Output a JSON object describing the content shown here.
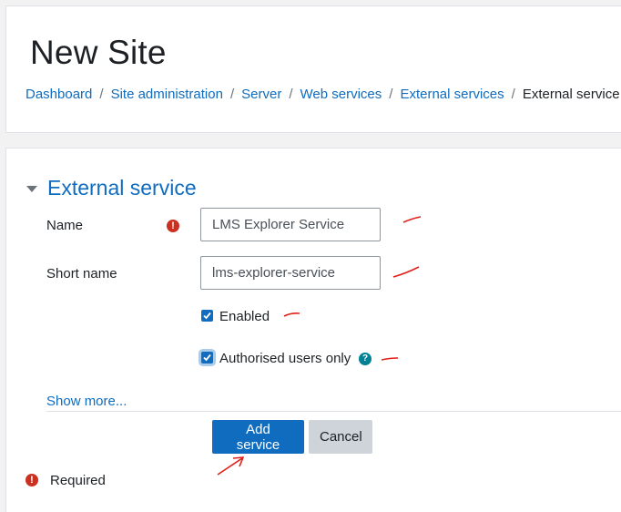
{
  "header": {
    "title": "New Site",
    "breadcrumb": [
      {
        "label": "Dashboard"
      },
      {
        "label": "Site administration"
      },
      {
        "label": "Server"
      },
      {
        "label": "Web services"
      },
      {
        "label": "External services"
      }
    ],
    "breadcrumb_current": "External service",
    "separator": "/"
  },
  "form": {
    "section_title": "External service",
    "name_label": "Name",
    "name_value": "LMS Explorer Service",
    "shortname_label": "Short name",
    "shortname_value": "lms-explorer-service",
    "enabled_label": "Enabled",
    "enabled_checked": true,
    "authorised_label": "Authorised users only",
    "authorised_checked": true,
    "show_more": "Show more...",
    "add_button": "Add service",
    "cancel_button": "Cancel",
    "required_note": "Required",
    "required_icon": "!",
    "help_icon": "?"
  },
  "colors": {
    "link": "#0f6cbf",
    "primary_button": "#0f6cbf",
    "required": "#ca3120",
    "help": "#008196",
    "annotation": "#e0201a"
  },
  "icons": {
    "caret": "caret-down-icon",
    "required": "exclamation-circle-icon",
    "help": "question-circle-icon"
  }
}
